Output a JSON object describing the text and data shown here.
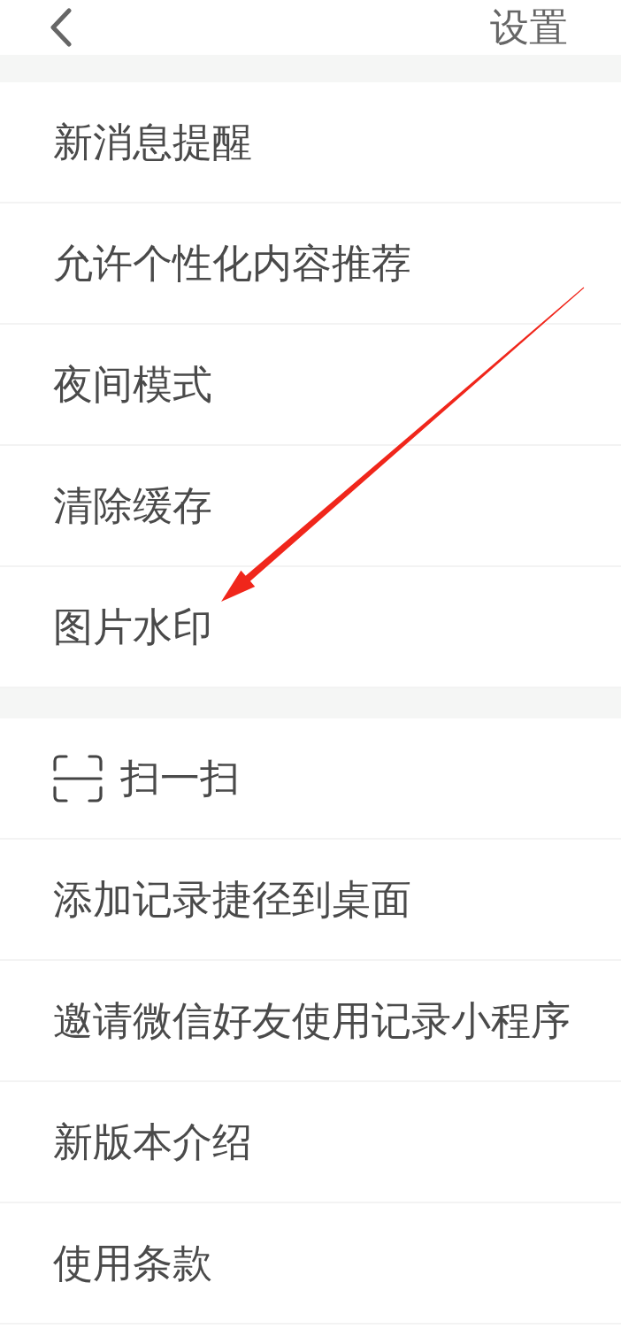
{
  "header": {
    "title": "设置"
  },
  "sections": [
    {
      "items": [
        {
          "kind": "text",
          "label": "新消息提醒"
        },
        {
          "kind": "text",
          "label": "允许个性化内容推荐"
        },
        {
          "kind": "text",
          "label": "夜间模式"
        },
        {
          "kind": "text",
          "label": "清除缓存"
        },
        {
          "kind": "text",
          "label": "图片水印"
        }
      ]
    },
    {
      "items": [
        {
          "kind": "scan",
          "label": "扫一扫"
        },
        {
          "kind": "text",
          "label": "添加记录捷径到桌面"
        },
        {
          "kind": "text",
          "label": "邀请微信好友使用记录小程序"
        },
        {
          "kind": "text",
          "label": "新版本介绍"
        },
        {
          "kind": "text",
          "label": "使用条款"
        }
      ]
    }
  ],
  "annotations": [
    {
      "kind": "arrow"
    }
  ]
}
